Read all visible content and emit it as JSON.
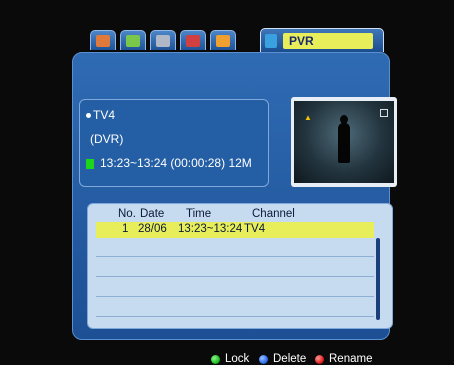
{
  "tabs": [
    {
      "name": "tab-installation",
      "icon": "installation-icon",
      "color": "#e07a3c"
    },
    {
      "name": "tab-tools",
      "icon": "tools-icon",
      "color": "#7ac84a"
    },
    {
      "name": "tab-games",
      "icon": "games-icon",
      "color": "#b0b8c8"
    },
    {
      "name": "tab-system",
      "icon": "system-icon",
      "color": "#d04040"
    },
    {
      "name": "tab-settings",
      "icon": "settings-icon",
      "color": "#f0a030"
    }
  ],
  "active_tab": {
    "label": "PVR",
    "icon": "pvr-icon"
  },
  "info": {
    "channel": "TV4",
    "type": "(DVR)",
    "recording": "13:23~13:24 (00:00:28) 12M"
  },
  "list": {
    "headers": {
      "no": "No.",
      "date": "Date",
      "time": "Time",
      "channel": "Channel"
    },
    "rows": [
      {
        "no": "1",
        "date": "28/06",
        "time": "13:23~13:24",
        "channel": "TV4"
      }
    ]
  },
  "footer": {
    "lock": "Lock",
    "delete": "Delete",
    "rename": "Rename"
  },
  "colors": {
    "green": "#1ec21e",
    "blue": "#2c6ff0",
    "red": "#e02020",
    "highlight": "#e8ee5a"
  }
}
